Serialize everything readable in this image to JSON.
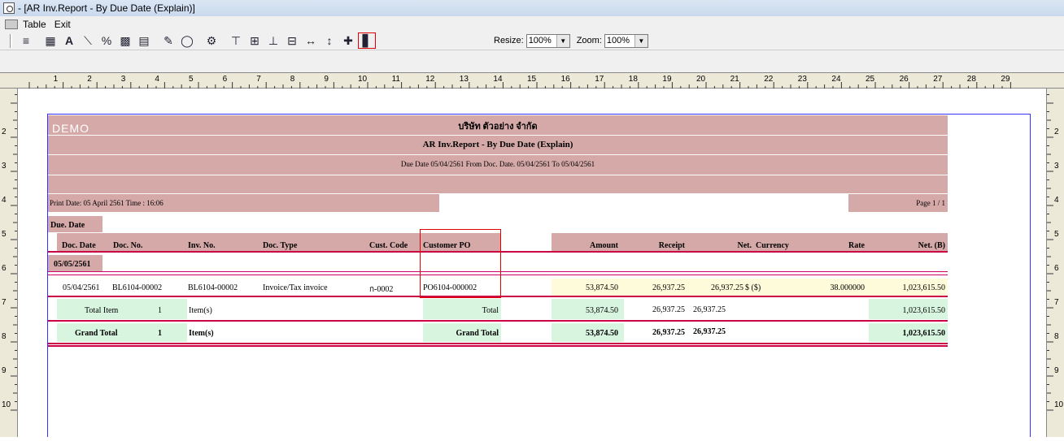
{
  "window": {
    "title": " - [AR Inv.Report - By Due Date (Explain)]"
  },
  "menu": {
    "items": [
      "Table",
      "Exit"
    ]
  },
  "toolbar": {
    "resize_label": "Resize:",
    "resize_value": "100%",
    "zoom_label": "Zoom:",
    "zoom_value": "100%"
  },
  "ruler": {
    "h_labels": [
      "1",
      "2",
      "3",
      "4",
      "5",
      "6",
      "7",
      "8",
      "9",
      "10",
      "11",
      "12",
      "13",
      "14",
      "15",
      "16",
      "17",
      "18",
      "19",
      "20",
      "21",
      "22",
      "23",
      "24",
      "25",
      "26",
      "27",
      "28",
      "29"
    ],
    "v_labels": [
      "2",
      "3",
      "4",
      "5",
      "6",
      "7",
      "8",
      "9",
      "10"
    ]
  },
  "report": {
    "watermark": "DEMO",
    "company": "บริษัท ตัวอย่าง จำกัด",
    "title": "AR Inv.Report - By Due Date (Explain)",
    "subtitle": "Due Date 05/04/2561 From Doc. Date. 05/04/2561 To 05/04/2561",
    "print_date": "Print Date: 05 April 2561  Time : 16:06",
    "page": "Page 1 / 1",
    "group_label": "Due. Date",
    "columns": {
      "doc_date": "Doc. Date",
      "doc_no": "Doc. No.",
      "inv_no": "Inv. No.",
      "doc_type": "Doc. Type",
      "cust_code": "Cust. Code",
      "customer_po": "Customer PO",
      "amount": "Amount",
      "receipt": "Receipt",
      "net": "Net.",
      "currency": "Currency",
      "rate": "Rate",
      "net_b": "Net. (B)"
    },
    "group_value": "05/05/2561",
    "row": {
      "doc_date": "05/04/2561",
      "doc_no": "BL6104-00002",
      "inv_no": "BL6104-00002",
      "doc_type": "Invoice/Tax invoice",
      "cust_code": "ก-0002",
      "customer_po": "PO6104-000002",
      "amount": "53,874.50",
      "receipt": "26,937.25",
      "net": "26,937.25",
      "currency": "$ ($)",
      "rate": "38.000000",
      "net_b": "1,023,615.50"
    },
    "total": {
      "label": "Total Item",
      "count": "1",
      "unit": "Item(s)",
      "title": "Total",
      "amount": "53,874.50",
      "receipt": "26,937.25",
      "net": "26,937.25",
      "net_b": "1,023,615.50"
    },
    "grand_total": {
      "label": "Grand Total",
      "count": "1",
      "unit": "Item(s)",
      "title": "Grand Total",
      "amount": "53,874.50",
      "receipt": "26,937.25",
      "net": "26,937.25",
      "net_b": "1,023,615.50"
    }
  }
}
